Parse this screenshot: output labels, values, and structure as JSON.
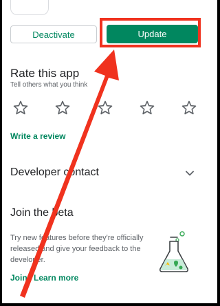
{
  "actions": {
    "deactivate_label": "Deactivate",
    "update_label": "Update"
  },
  "rating": {
    "title": "Rate this app",
    "subtitle": "Tell others what you think",
    "star_count": 5,
    "write_review": "Write a review"
  },
  "developer": {
    "title": "Developer contact"
  },
  "beta": {
    "title": "Join the beta",
    "body": "Try new features before they're officially released and give your feedback to the developer.",
    "join_label": "Join",
    "learn_more_label": "Learn more"
  },
  "colors": {
    "accent_green": "#01875f",
    "annotation_red": "#f0321e"
  },
  "icons": {
    "star": "star-outline-icon",
    "chevron": "chevron-down-icon",
    "beaker": "beaker-illustration"
  }
}
